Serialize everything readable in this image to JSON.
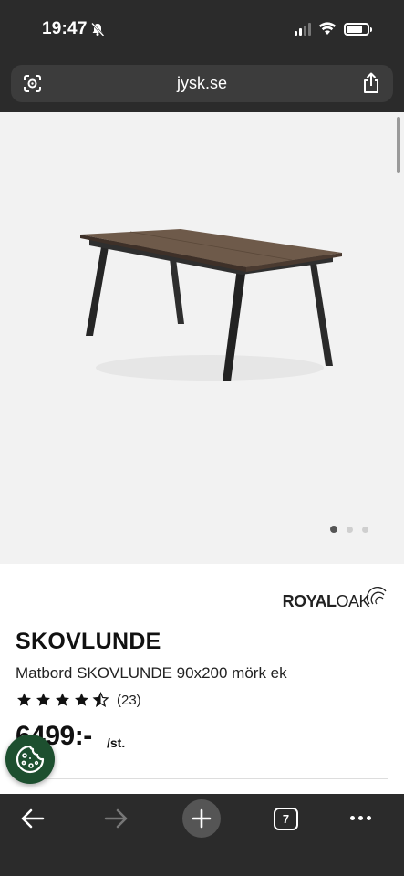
{
  "status_bar": {
    "time": "19:47"
  },
  "browser": {
    "url": "jysk.se",
    "open_tabs": "7"
  },
  "product": {
    "brand": {
      "part1": "ROYAL",
      "part2": "OAK"
    },
    "name": "SKOVLUNDE",
    "description": "Matbord SKOVLUNDE 90x200 mörk ek",
    "rating": {
      "stars": 4.5,
      "max": 5,
      "count_label": "(23)"
    },
    "price": "6499:-",
    "price_unit": "/st.",
    "gallery": {
      "images": 3,
      "active_index": 0
    }
  },
  "colors": {
    "chrome_bg": "#2b2b2b",
    "cookie_button": "#1d4f2f",
    "image_bg": "#f2f2f2"
  }
}
